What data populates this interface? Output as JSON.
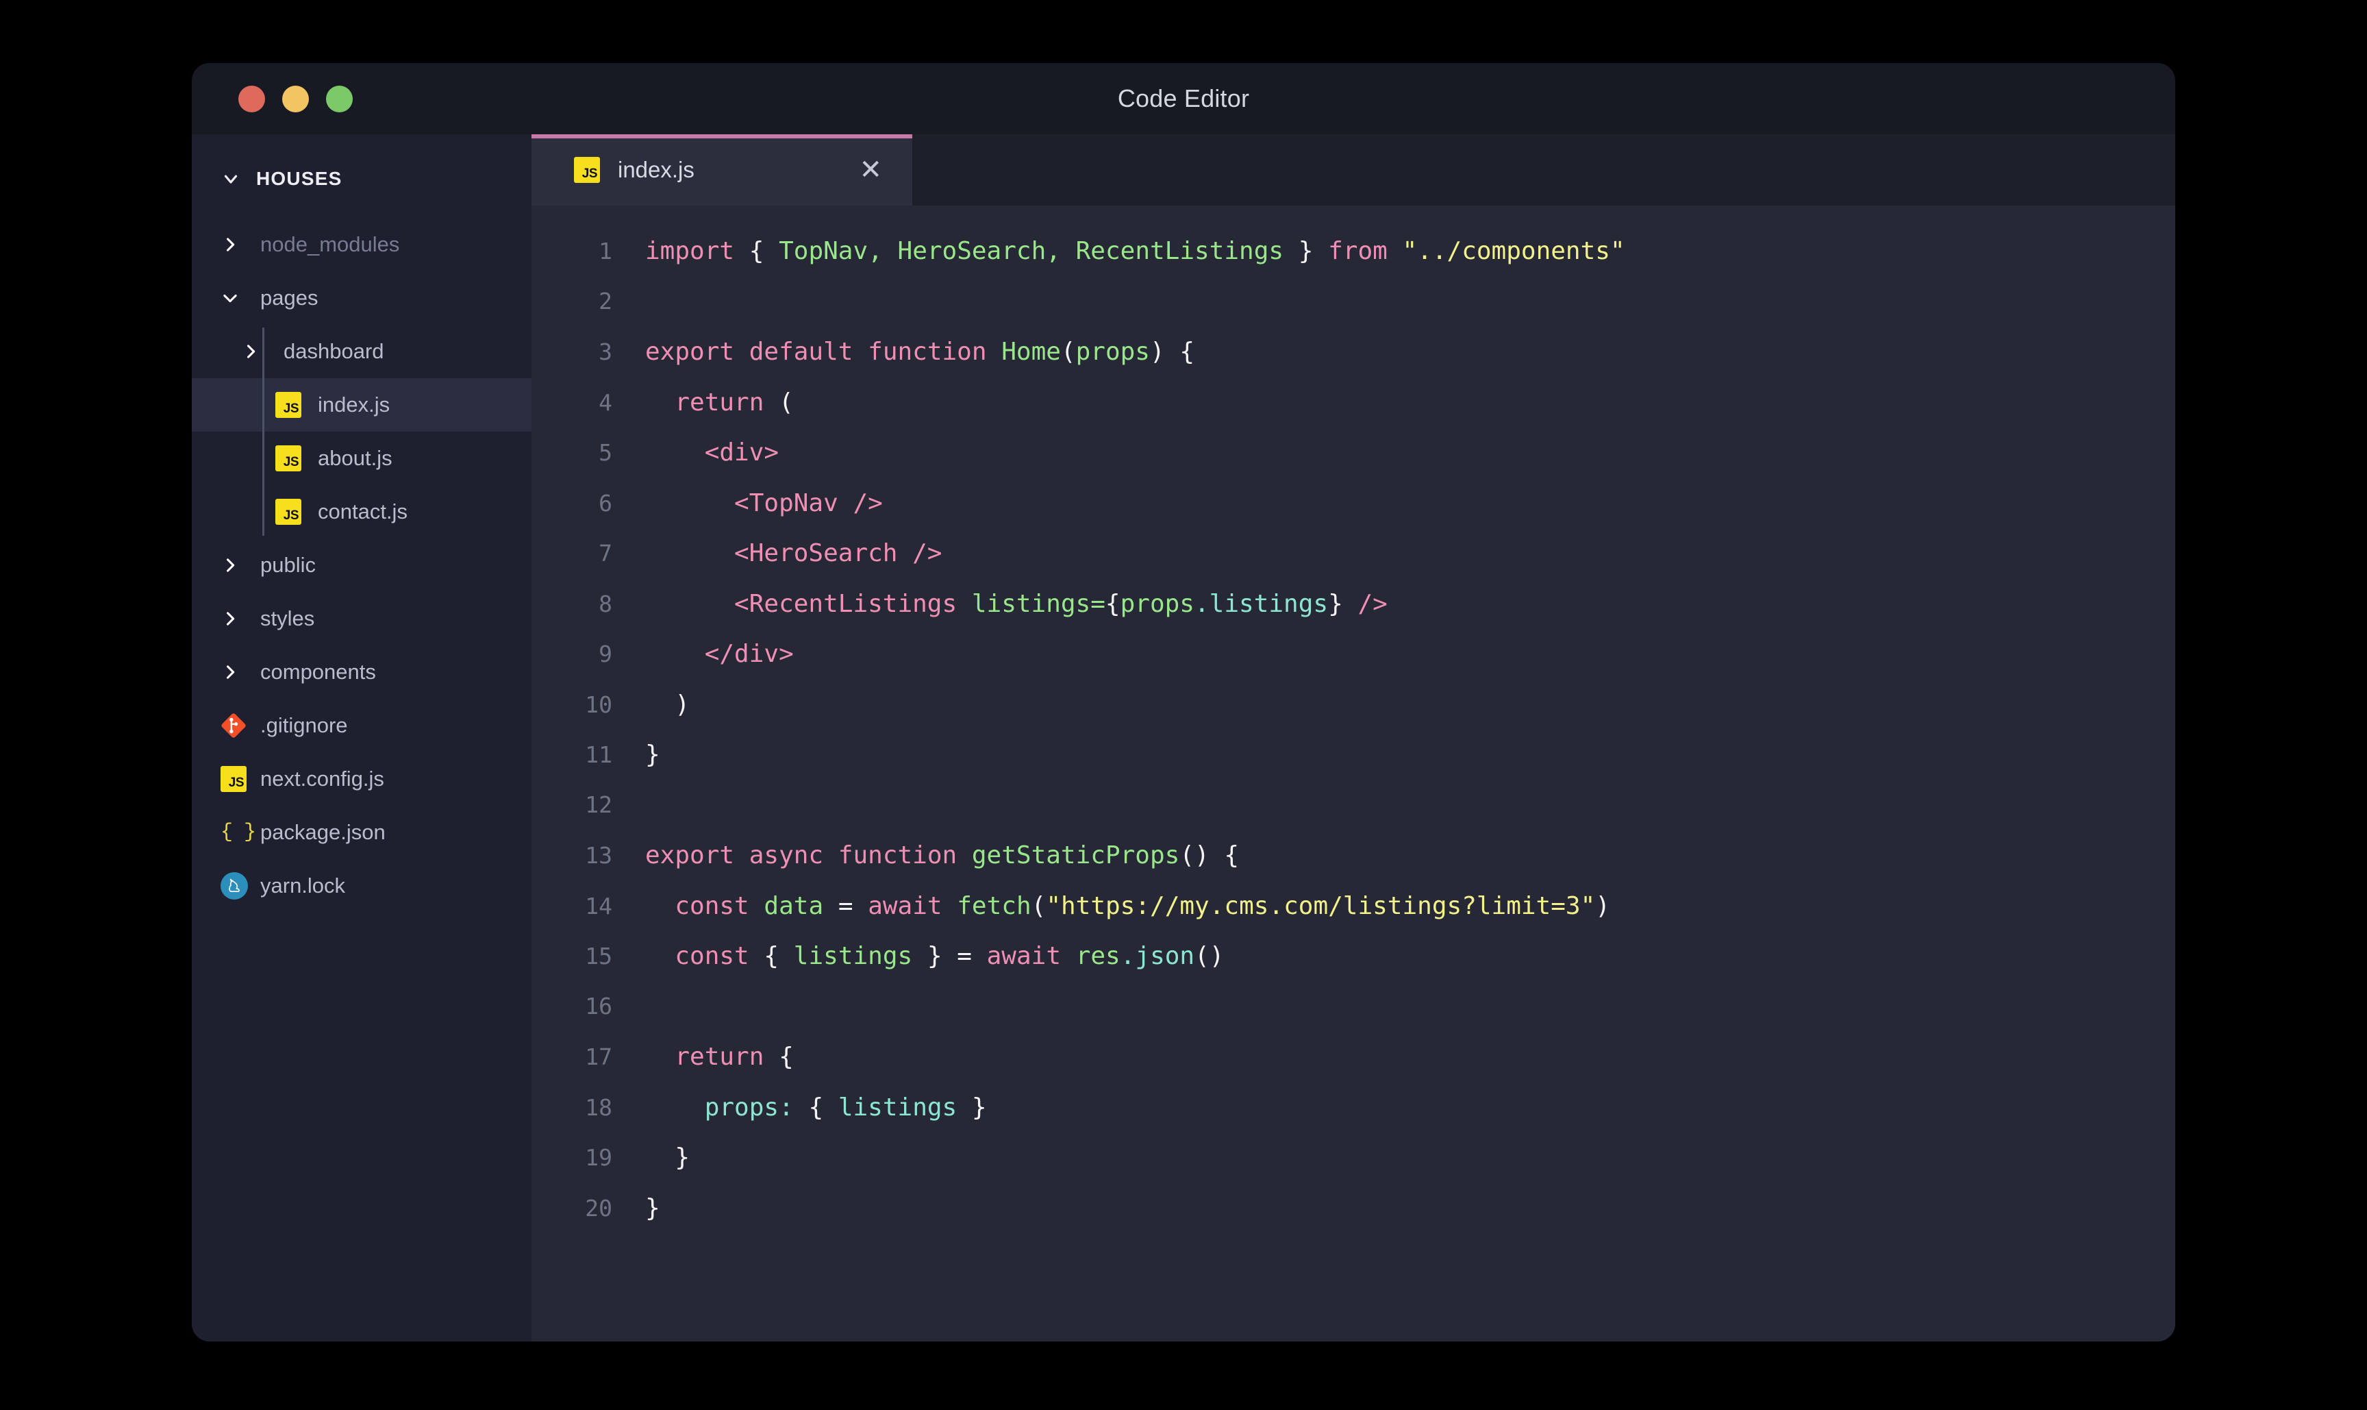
{
  "window": {
    "title": "Code Editor",
    "traffic_lights": [
      "close-red",
      "minimize-yellow",
      "zoom-green"
    ]
  },
  "sidebar": {
    "header": {
      "label": "HOUSES",
      "chevron": "chevron-down-icon"
    },
    "items": [
      {
        "label": "node_modules",
        "depth": 0,
        "kind": "folder",
        "icon": "chevron-right-icon",
        "state": "collapsed",
        "muted": true,
        "active": false
      },
      {
        "label": "pages",
        "depth": 0,
        "kind": "folder",
        "icon": "chevron-down-icon",
        "state": "expanded",
        "muted": false,
        "active": false
      },
      {
        "label": "dashboard",
        "depth": 1,
        "kind": "folder",
        "icon": "chevron-right-icon",
        "state": "collapsed",
        "muted": false,
        "active": false
      },
      {
        "label": "index.js",
        "depth": 2,
        "kind": "file",
        "icon": "js-file-icon",
        "state": "",
        "muted": false,
        "active": true
      },
      {
        "label": "about.js",
        "depth": 2,
        "kind": "file",
        "icon": "js-file-icon",
        "state": "",
        "muted": false,
        "active": false
      },
      {
        "label": "contact.js",
        "depth": 2,
        "kind": "file",
        "icon": "js-file-icon",
        "state": "",
        "muted": false,
        "active": false
      },
      {
        "label": "public",
        "depth": 0,
        "kind": "folder",
        "icon": "chevron-right-icon",
        "state": "collapsed",
        "muted": false,
        "active": false
      },
      {
        "label": "styles",
        "depth": 0,
        "kind": "folder",
        "icon": "chevron-right-icon",
        "state": "collapsed",
        "muted": false,
        "active": false
      },
      {
        "label": "components",
        "depth": 0,
        "kind": "folder",
        "icon": "chevron-right-icon",
        "state": "collapsed",
        "muted": false,
        "active": false
      },
      {
        "label": ".gitignore",
        "depth": 0,
        "kind": "file",
        "icon": "git-file-icon",
        "state": "",
        "muted": false,
        "active": false
      },
      {
        "label": "next.config.js",
        "depth": 0,
        "kind": "file",
        "icon": "js-file-icon",
        "state": "",
        "muted": false,
        "active": false
      },
      {
        "label": "package.json",
        "depth": 0,
        "kind": "file",
        "icon": "json-file-icon",
        "state": "",
        "muted": false,
        "active": false
      },
      {
        "label": "yarn.lock",
        "depth": 0,
        "kind": "file",
        "icon": "yarn-file-icon",
        "state": "",
        "muted": false,
        "active": false
      }
    ]
  },
  "tabs": [
    {
      "label": "index.js",
      "icon": "js-file-icon",
      "close_icon": "close-icon",
      "close_glyph": "✕",
      "active": true
    }
  ],
  "editor": {
    "filename": "index.js",
    "line_count": 20,
    "lines": [
      {
        "n": 1,
        "tokens": [
          {
            "t": "import",
            "c": "kw"
          },
          {
            "t": " ",
            "c": "punc"
          },
          {
            "t": "{",
            "c": "punc"
          },
          {
            "t": " ",
            "c": "punc"
          },
          {
            "t": "TopNav",
            "c": "var"
          },
          {
            "t": ", ",
            "c": "var"
          },
          {
            "t": "HeroSearch",
            "c": "var"
          },
          {
            "t": ", ",
            "c": "var"
          },
          {
            "t": "RecentListings",
            "c": "var"
          },
          {
            "t": " ",
            "c": "punc"
          },
          {
            "t": "}",
            "c": "punc"
          },
          {
            "t": " ",
            "c": "punc"
          },
          {
            "t": "from",
            "c": "kw"
          },
          {
            "t": " ",
            "c": "punc"
          },
          {
            "t": "\"../components\"",
            "c": "str"
          }
        ]
      },
      {
        "n": 2,
        "tokens": []
      },
      {
        "n": 3,
        "tokens": [
          {
            "t": "export",
            "c": "kw"
          },
          {
            "t": " ",
            "c": "punc"
          },
          {
            "t": "default",
            "c": "kw"
          },
          {
            "t": " ",
            "c": "punc"
          },
          {
            "t": "function",
            "c": "kw"
          },
          {
            "t": " ",
            "c": "punc"
          },
          {
            "t": "Home",
            "c": "fn"
          },
          {
            "t": "(",
            "c": "punc"
          },
          {
            "t": "props",
            "c": "var"
          },
          {
            "t": ")",
            "c": "punc"
          },
          {
            "t": " ",
            "c": "punc"
          },
          {
            "t": "{",
            "c": "punc"
          }
        ]
      },
      {
        "n": 4,
        "tokens": [
          {
            "t": "  ",
            "c": "punc"
          },
          {
            "t": "return",
            "c": "kw"
          },
          {
            "t": " ",
            "c": "punc"
          },
          {
            "t": "(",
            "c": "punc"
          }
        ]
      },
      {
        "n": 5,
        "tokens": [
          {
            "t": "    ",
            "c": "punc"
          },
          {
            "t": "<div>",
            "c": "tag"
          }
        ]
      },
      {
        "n": 6,
        "tokens": [
          {
            "t": "      ",
            "c": "punc"
          },
          {
            "t": "<TopNav />",
            "c": "tag"
          }
        ]
      },
      {
        "n": 7,
        "tokens": [
          {
            "t": "      ",
            "c": "punc"
          },
          {
            "t": "<HeroSearch />",
            "c": "tag"
          }
        ]
      },
      {
        "n": 8,
        "tokens": [
          {
            "t": "      ",
            "c": "punc"
          },
          {
            "t": "<RecentListings",
            "c": "tag"
          },
          {
            "t": " ",
            "c": "punc"
          },
          {
            "t": "listings",
            "c": "attr"
          },
          {
            "t": "=",
            "c": "attr"
          },
          {
            "t": "{",
            "c": "punc"
          },
          {
            "t": "props",
            "c": "var"
          },
          {
            "t": ".",
            "c": "prop"
          },
          {
            "t": "listings",
            "c": "prop"
          },
          {
            "t": "}",
            "c": "punc"
          },
          {
            "t": " ",
            "c": "punc"
          },
          {
            "t": "/>",
            "c": "tag"
          }
        ]
      },
      {
        "n": 9,
        "tokens": [
          {
            "t": "    ",
            "c": "punc"
          },
          {
            "t": "</div>",
            "c": "tag"
          }
        ]
      },
      {
        "n": 10,
        "tokens": [
          {
            "t": "  ",
            "c": "punc"
          },
          {
            "t": ")",
            "c": "punc"
          }
        ]
      },
      {
        "n": 11,
        "tokens": [
          {
            "t": "}",
            "c": "punc"
          }
        ]
      },
      {
        "n": 12,
        "tokens": []
      },
      {
        "n": 13,
        "tokens": [
          {
            "t": "export",
            "c": "kw"
          },
          {
            "t": " ",
            "c": "punc"
          },
          {
            "t": "async",
            "c": "kw"
          },
          {
            "t": " ",
            "c": "punc"
          },
          {
            "t": "function",
            "c": "kw"
          },
          {
            "t": " ",
            "c": "punc"
          },
          {
            "t": "getStaticProps",
            "c": "fn"
          },
          {
            "t": "()",
            "c": "punc"
          },
          {
            "t": " ",
            "c": "punc"
          },
          {
            "t": "{",
            "c": "punc"
          }
        ]
      },
      {
        "n": 14,
        "tokens": [
          {
            "t": "  ",
            "c": "punc"
          },
          {
            "t": "const",
            "c": "kw"
          },
          {
            "t": " ",
            "c": "punc"
          },
          {
            "t": "data",
            "c": "var"
          },
          {
            "t": " ",
            "c": "punc"
          },
          {
            "t": "=",
            "c": "punc"
          },
          {
            "t": " ",
            "c": "punc"
          },
          {
            "t": "await",
            "c": "kw"
          },
          {
            "t": " ",
            "c": "punc"
          },
          {
            "t": "fetch",
            "c": "fn"
          },
          {
            "t": "(",
            "c": "punc"
          },
          {
            "t": "\"https://my.cms.com/listings?limit=3\"",
            "c": "str"
          },
          {
            "t": ")",
            "c": "punc"
          }
        ]
      },
      {
        "n": 15,
        "tokens": [
          {
            "t": "  ",
            "c": "punc"
          },
          {
            "t": "const",
            "c": "kw"
          },
          {
            "t": " ",
            "c": "punc"
          },
          {
            "t": "{",
            "c": "punc"
          },
          {
            "t": " ",
            "c": "punc"
          },
          {
            "t": "listings",
            "c": "var"
          },
          {
            "t": " ",
            "c": "punc"
          },
          {
            "t": "}",
            "c": "punc"
          },
          {
            "t": " ",
            "c": "punc"
          },
          {
            "t": "=",
            "c": "punc"
          },
          {
            "t": " ",
            "c": "punc"
          },
          {
            "t": "await",
            "c": "kw"
          },
          {
            "t": " ",
            "c": "punc"
          },
          {
            "t": "res",
            "c": "var"
          },
          {
            "t": ".",
            "c": "prop"
          },
          {
            "t": "json",
            "c": "prop"
          },
          {
            "t": "()",
            "c": "punc"
          }
        ]
      },
      {
        "n": 16,
        "tokens": []
      },
      {
        "n": 17,
        "tokens": [
          {
            "t": "  ",
            "c": "punc"
          },
          {
            "t": "return",
            "c": "kw"
          },
          {
            "t": " ",
            "c": "punc"
          },
          {
            "t": "{",
            "c": "punc"
          }
        ]
      },
      {
        "n": 18,
        "tokens": [
          {
            "t": "    ",
            "c": "punc"
          },
          {
            "t": "props",
            "c": "prop"
          },
          {
            "t": ":",
            "c": "prop"
          },
          {
            "t": " ",
            "c": "punc"
          },
          {
            "t": "{",
            "c": "punc"
          },
          {
            "t": " ",
            "c": "punc"
          },
          {
            "t": "listings",
            "c": "prop"
          },
          {
            "t": " ",
            "c": "punc"
          },
          {
            "t": "}",
            "c": "punc"
          }
        ]
      },
      {
        "n": 19,
        "tokens": [
          {
            "t": "  ",
            "c": "punc"
          },
          {
            "t": "}",
            "c": "punc"
          }
        ]
      },
      {
        "n": 20,
        "tokens": [
          {
            "t": "}",
            "c": "punc"
          }
        ]
      }
    ]
  },
  "colors": {
    "page_background": "#000000",
    "window_background": "#1b1d27",
    "titlebar": "#181a23",
    "sidebar": "#1e2030",
    "sidebar_active_row": "#2b2e40",
    "tabbar": "#1d1f2b",
    "tab_active": "#2c2e3e",
    "tab_accent": "#c678a9",
    "editor_background": "#262836",
    "line_number": "#6f7484",
    "keyword": "#f08fb4",
    "identifier": "#9ae68a",
    "string": "#f2f18c",
    "property": "#8de6d4",
    "punctuation": "#f4f5f9",
    "js_icon": "#f7df1e",
    "git_icon": "#f34f29",
    "yarn_icon": "#2c8ebb",
    "json_icon": "#e8d44d",
    "traffic_red": "#df6a5b",
    "traffic_yellow": "#f2c462",
    "traffic_green": "#7cc96a"
  }
}
